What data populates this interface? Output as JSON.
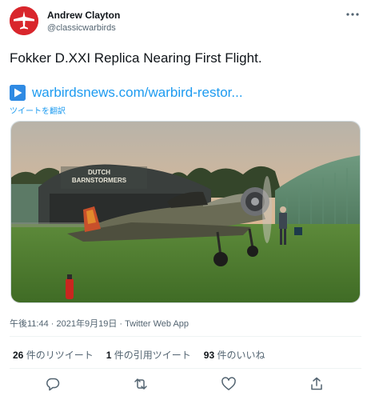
{
  "author": {
    "name": "Andrew Clayton",
    "handle": "@classicwarbirds"
  },
  "tweet": {
    "text": "Fokker D.XXI Replica Nearing First Flight.",
    "link": "warbirdsnews.com/warbird-restor...",
    "translate": "ツイートを翻訳"
  },
  "media": {
    "hangar_sign_line1": "DUTCH",
    "hangar_sign_line2": "BARNSTORMERS"
  },
  "meta": {
    "time": "午後11:44",
    "date": "2021年9月19日",
    "app": "Twitter Web App",
    "sep1": "·",
    "sep2": "·"
  },
  "stats": {
    "retweets_count": "26",
    "retweets_label": "件のリツイート",
    "quotes_count": "1",
    "quotes_label": "件の引用ツイート",
    "likes_count": "93",
    "likes_label": "件のいいね"
  },
  "icons": {
    "avatar": "red-plane-avatar-icon",
    "more": "more-dots-icon",
    "link": "play-arrow-icon",
    "reply": "reply-icon",
    "retweet": "retweet-icon",
    "like": "heart-icon",
    "share": "share-icon"
  },
  "colors": {
    "accent": "#1d9bf0",
    "avatar_bg": "#d9262c"
  }
}
